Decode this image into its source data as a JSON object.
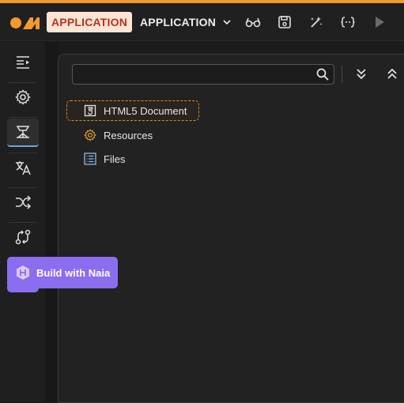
{
  "header": {
    "app_badge": "APPLICATION",
    "app_selector": "APPLICATION",
    "icons": [
      "preview-glasses-icon",
      "save-icon",
      "magic-wand-icon",
      "code-braces-icon",
      "play-icon"
    ]
  },
  "sidebar": {
    "items": [
      {
        "icon": "outline-list-icon"
      },
      {
        "icon": "settings-gear-icon"
      },
      {
        "icon": "structure-tree-icon",
        "active": true
      },
      {
        "icon": "translate-icon"
      },
      {
        "icon": "shuffle-icon"
      },
      {
        "icon": "workflow-icon"
      }
    ]
  },
  "panel": {
    "search": {
      "value": "",
      "placeholder": ""
    },
    "tree": [
      {
        "label": "HTML5 Document",
        "icon": "html5-icon",
        "selected": true
      },
      {
        "label": "Resources",
        "icon": "gear-icon"
      },
      {
        "label": "Files",
        "icon": "file-list-icon"
      }
    ]
  },
  "naia_button": {
    "label": "Build with Naia"
  },
  "colors": {
    "accent": "#f39a2e",
    "badge_bg": "#fde5d6",
    "badge_text": "#b4331e",
    "naia": "#8b6df0",
    "active_underline": "#6aa3e0"
  }
}
